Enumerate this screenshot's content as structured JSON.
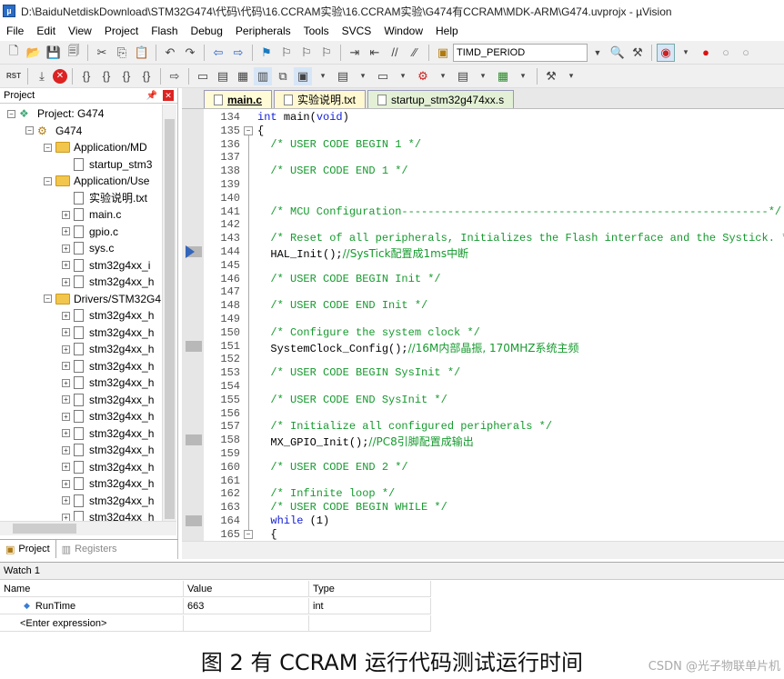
{
  "window": {
    "title": "D:\\BaiduNetdiskDownload\\STM32G474\\代码\\代码\\16.CCRAM实验\\16.CCRAM实验\\G474有CCRAM\\MDK-ARM\\G474.uvprojx - µVision"
  },
  "menu": [
    "File",
    "Edit",
    "View",
    "Project",
    "Flash",
    "Debug",
    "Peripherals",
    "Tools",
    "SVCS",
    "Window",
    "Help"
  ],
  "toolbar": {
    "target_combo": "TIMD_PERIOD",
    "rst_label": "RST"
  },
  "project_panel": {
    "title": "Project",
    "tree": [
      {
        "label": "Project: G474",
        "level": 0,
        "kind": "project",
        "expander": "−"
      },
      {
        "label": "G474",
        "level": 1,
        "kind": "target",
        "expander": "−"
      },
      {
        "label": "Application/MD",
        "level": 2,
        "kind": "folder",
        "expander": "−"
      },
      {
        "label": "startup_stm3",
        "level": 3,
        "kind": "file",
        "expander": ""
      },
      {
        "label": "Application/Use",
        "level": 2,
        "kind": "folder",
        "expander": "−"
      },
      {
        "label": "实验说明.txt",
        "level": 3,
        "kind": "file",
        "expander": ""
      },
      {
        "label": "main.c",
        "level": 3,
        "kind": "file",
        "expander": "+"
      },
      {
        "label": "gpio.c",
        "level": 3,
        "kind": "file",
        "expander": "+"
      },
      {
        "label": "sys.c",
        "level": 3,
        "kind": "file",
        "expander": "+"
      },
      {
        "label": "stm32g4xx_i",
        "level": 3,
        "kind": "file",
        "expander": "+"
      },
      {
        "label": "stm32g4xx_h",
        "level": 3,
        "kind": "file",
        "expander": "+"
      },
      {
        "label": "Drivers/STM32G4",
        "level": 2,
        "kind": "folder",
        "expander": "−"
      },
      {
        "label": "stm32g4xx_h",
        "level": 3,
        "kind": "file",
        "expander": "+"
      },
      {
        "label": "stm32g4xx_h",
        "level": 3,
        "kind": "file",
        "expander": "+"
      },
      {
        "label": "stm32g4xx_h",
        "level": 3,
        "kind": "file",
        "expander": "+"
      },
      {
        "label": "stm32g4xx_h",
        "level": 3,
        "kind": "file",
        "expander": "+"
      },
      {
        "label": "stm32g4xx_h",
        "level": 3,
        "kind": "file",
        "expander": "+"
      },
      {
        "label": "stm32g4xx_h",
        "level": 3,
        "kind": "file",
        "expander": "+"
      },
      {
        "label": "stm32g4xx_h",
        "level": 3,
        "kind": "file",
        "expander": "+"
      },
      {
        "label": "stm32g4xx_h",
        "level": 3,
        "kind": "file",
        "expander": "+"
      },
      {
        "label": "stm32g4xx_h",
        "level": 3,
        "kind": "file",
        "expander": "+"
      },
      {
        "label": "stm32g4xx_h",
        "level": 3,
        "kind": "file",
        "expander": "+"
      },
      {
        "label": "stm32g4xx_h",
        "level": 3,
        "kind": "file",
        "expander": "+"
      },
      {
        "label": "stm32g4xx_h",
        "level": 3,
        "kind": "file",
        "expander": "+"
      },
      {
        "label": "stm32g4xx_h",
        "level": 3,
        "kind": "file",
        "expander": "+"
      }
    ],
    "tabs": [
      "Project",
      "Registers"
    ]
  },
  "editor": {
    "tabs": [
      "main.c",
      "实验说明.txt",
      "startup_stm32g474xx.s"
    ],
    "lines": [
      {
        "n": "134",
        "parts": [
          {
            "t": "int ",
            "c": "kw"
          },
          {
            "t": "main(",
            "c": ""
          },
          {
            "t": "void",
            "c": "kw"
          },
          {
            "t": ")",
            "c": ""
          }
        ],
        "fold": "",
        "mark": ""
      },
      {
        "n": "135",
        "parts": [
          {
            "t": "{",
            "c": ""
          }
        ],
        "fold": "−",
        "mark": ""
      },
      {
        "n": "136",
        "parts": [
          {
            "t": "  /* USER CODE BEGIN 1 */",
            "c": "cmt"
          }
        ],
        "fold": "",
        "mark": ""
      },
      {
        "n": "137",
        "parts": [],
        "fold": "",
        "mark": ""
      },
      {
        "n": "138",
        "parts": [
          {
            "t": "  /* USER CODE END 1 */",
            "c": "cmt"
          }
        ],
        "fold": "",
        "mark": ""
      },
      {
        "n": "139",
        "parts": [],
        "fold": "",
        "mark": ""
      },
      {
        "n": "140",
        "parts": [],
        "fold": "",
        "mark": ""
      },
      {
        "n": "141",
        "parts": [
          {
            "t": "  /* MCU Configuration--------------------------------------------------------*/",
            "c": "cmt"
          }
        ],
        "fold": "",
        "mark": ""
      },
      {
        "n": "142",
        "parts": [],
        "fold": "",
        "mark": ""
      },
      {
        "n": "143",
        "parts": [
          {
            "t": "  /* Reset of all peripherals, Initializes the Flash interface and the Systick. */",
            "c": "cmt"
          }
        ],
        "fold": "",
        "mark": ""
      },
      {
        "n": "144",
        "parts": [
          {
            "t": "  HAL_Init();",
            "c": ""
          },
          {
            "t": "//SysTick配置成1ms中断",
            "c": "cmt"
          }
        ],
        "fold": "",
        "mark": "arrow"
      },
      {
        "n": "145",
        "parts": [],
        "fold": "",
        "mark": ""
      },
      {
        "n": "146",
        "parts": [
          {
            "t": "  /* USER CODE BEGIN Init */",
            "c": "cmt"
          }
        ],
        "fold": "",
        "mark": ""
      },
      {
        "n": "147",
        "parts": [],
        "fold": "",
        "mark": ""
      },
      {
        "n": "148",
        "parts": [
          {
            "t": "  /* USER CODE END Init */",
            "c": "cmt"
          }
        ],
        "fold": "",
        "mark": ""
      },
      {
        "n": "149",
        "parts": [],
        "fold": "",
        "mark": ""
      },
      {
        "n": "150",
        "parts": [
          {
            "t": "  /* Configure the system clock */",
            "c": "cmt"
          }
        ],
        "fold": "",
        "mark": ""
      },
      {
        "n": "151",
        "parts": [
          {
            "t": "  SystemClock_Config();",
            "c": ""
          },
          {
            "t": "//16M内部晶振, 170MHZ系统主频",
            "c": "cmt"
          }
        ],
        "fold": "",
        "mark": "bp"
      },
      {
        "n": "152",
        "parts": [],
        "fold": "",
        "mark": ""
      },
      {
        "n": "153",
        "parts": [
          {
            "t": "  /* USER CODE BEGIN SysInit */",
            "c": "cmt"
          }
        ],
        "fold": "",
        "mark": ""
      },
      {
        "n": "154",
        "parts": [],
        "fold": "",
        "mark": ""
      },
      {
        "n": "155",
        "parts": [
          {
            "t": "  /* USER CODE END SysInit */",
            "c": "cmt"
          }
        ],
        "fold": "",
        "mark": ""
      },
      {
        "n": "156",
        "parts": [],
        "fold": "",
        "mark": ""
      },
      {
        "n": "157",
        "parts": [
          {
            "t": "  /* Initialize all configured peripherals */",
            "c": "cmt"
          }
        ],
        "fold": "",
        "mark": ""
      },
      {
        "n": "158",
        "parts": [
          {
            "t": "  MX_GPIO_Init();",
            "c": ""
          },
          {
            "t": "//PC8引脚配置成输出",
            "c": "cmt"
          }
        ],
        "fold": "",
        "mark": "bp"
      },
      {
        "n": "159",
        "parts": [],
        "fold": "",
        "mark": ""
      },
      {
        "n": "160",
        "parts": [
          {
            "t": "  /* USER CODE END 2 */",
            "c": "cmt"
          }
        ],
        "fold": "",
        "mark": ""
      },
      {
        "n": "161",
        "parts": [],
        "fold": "",
        "mark": ""
      },
      {
        "n": "162",
        "parts": [
          {
            "t": "  /* Infinite loop */",
            "c": "cmt"
          }
        ],
        "fold": "",
        "mark": ""
      },
      {
        "n": "163",
        "parts": [
          {
            "t": "  /* USER CODE BEGIN WHILE */",
            "c": "cmt"
          }
        ],
        "fold": "",
        "mark": ""
      },
      {
        "n": "164",
        "parts": [
          {
            "t": "  while ",
            "c": "kw"
          },
          {
            "t": "(1)",
            "c": ""
          }
        ],
        "fold": "",
        "mark": "bp"
      },
      {
        "n": "165",
        "parts": [
          {
            "t": "  {",
            "c": ""
          }
        ],
        "fold": "−",
        "mark": ""
      }
    ]
  },
  "watch": {
    "title": "Watch 1",
    "headers": [
      "Name",
      "Value",
      "Type"
    ],
    "rows": [
      {
        "name": "RunTime",
        "value": "663",
        "type": "int"
      },
      {
        "name": "<Enter expression>",
        "value": "",
        "type": ""
      }
    ]
  },
  "caption": "图 2  有 CCRAM 运行代码测试运行时间",
  "watermark": "CSDN @光子物联单片机"
}
